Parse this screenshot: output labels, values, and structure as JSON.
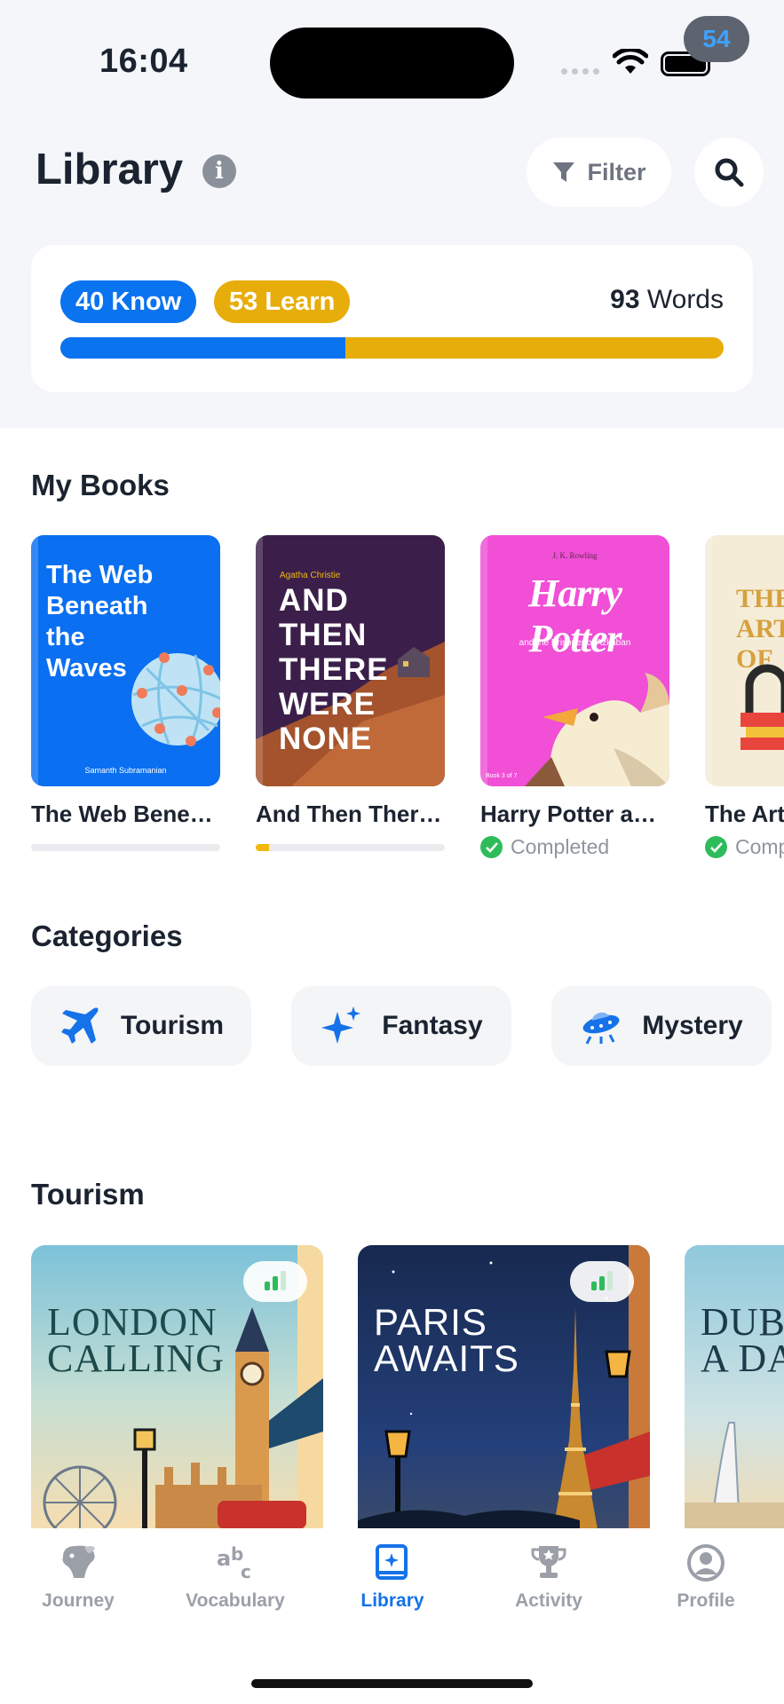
{
  "status_bar": {
    "time": "16:04",
    "notification_count": "54"
  },
  "header": {
    "title": "Library",
    "filter_label": "Filter"
  },
  "stats": {
    "know_label": "40 Know",
    "learn_label": "53 Learn",
    "words_count": "93",
    "words_label": "Words",
    "know_fraction": 0.43
  },
  "my_books": {
    "title": "My Books",
    "books": [
      {
        "title": "The Web Bene…",
        "cover_text": "The Web Beneath the Waves",
        "author": "Samanth Subramanian",
        "progress": 0,
        "status": ""
      },
      {
        "title": "And Then Ther…",
        "cover_text": "AND THEN THERE WERE NONE",
        "author": "Agatha Christie",
        "progress": 0.07,
        "status": ""
      },
      {
        "title": "Harry Potter an…",
        "cover_text": "Harry Potter",
        "author": "J. K. Rowling",
        "subtitle": "and the Prisoner of Azkaban",
        "series": "Book 3 of 7",
        "status": "Completed"
      },
      {
        "title": "The Art",
        "cover_text": "THE ART OF",
        "status": "Comp"
      }
    ]
  },
  "categories": {
    "title": "Categories",
    "items": [
      {
        "label": "Tourism",
        "icon": "airplane-icon"
      },
      {
        "label": "Fantasy",
        "icon": "sparkles-icon"
      },
      {
        "label": "Mystery",
        "icon": "ufo-icon"
      }
    ]
  },
  "tourism": {
    "title": "Tourism",
    "cards": [
      {
        "cover_text": "LONDON\nCALLING"
      },
      {
        "cover_text": "PARIS\nAWAITS"
      },
      {
        "cover_text": "DUB\nA DA"
      }
    ]
  },
  "nav": {
    "items": [
      {
        "label": "Journey",
        "icon": "mascot-icon"
      },
      {
        "label": "Vocabulary",
        "icon": "abc-icon"
      },
      {
        "label": "Library",
        "icon": "library-book-icon",
        "active": true
      },
      {
        "label": "Activity",
        "icon": "trophy-icon"
      },
      {
        "label": "Profile",
        "icon": "profile-icon"
      }
    ]
  },
  "colors": {
    "know": "#0a73f0",
    "learn": "#e7ad0a",
    "active": "#1572e8",
    "completed": "#2ebc5a"
  }
}
